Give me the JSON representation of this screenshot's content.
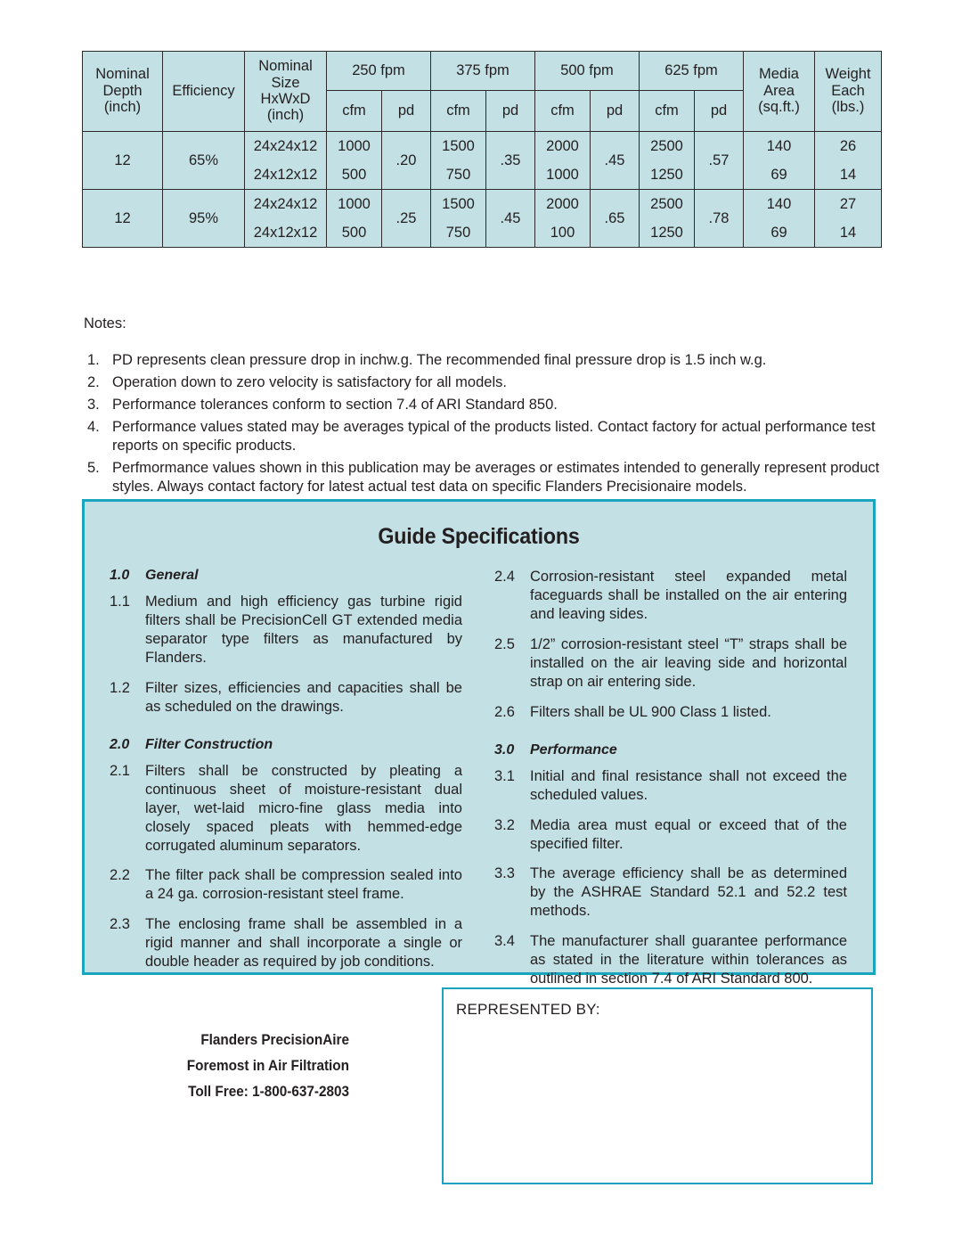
{
  "table": {
    "headers": {
      "nominal_depth": [
        "Nominal",
        "Depth",
        "(inch)"
      ],
      "efficiency": "Efficiency",
      "nominal_size": [
        "Nominal",
        "Size",
        "HxWxD",
        "(inch)"
      ],
      "velocity_groups": [
        "250 fpm",
        "375 fpm",
        "500 fpm",
        "625 fpm"
      ],
      "sub_cfm": "cfm",
      "sub_pd": "pd",
      "media_area": [
        "Media",
        "Area",
        "(sq.ft.)"
      ],
      "weight_each": [
        "Weight",
        "Each",
        "(lbs.)"
      ]
    },
    "rows": [
      {
        "depth": "12",
        "efficiency": "65%",
        "sizes": [
          "24x24x12",
          "24x12x12"
        ],
        "cfm_250": [
          "1000",
          "500"
        ],
        "pd_250": ".20",
        "cfm_375": [
          "1500",
          "750"
        ],
        "pd_375": ".35",
        "cfm_500": [
          "2000",
          "1000"
        ],
        "pd_500": ".45",
        "cfm_625": [
          "2500",
          "1250"
        ],
        "pd_625": ".57",
        "media_area": [
          "140",
          "69"
        ],
        "weight": [
          "26",
          "14"
        ]
      },
      {
        "depth": "12",
        "efficiency": "95%",
        "sizes": [
          "24x24x12",
          "24x12x12"
        ],
        "cfm_250": [
          "1000",
          "500"
        ],
        "pd_250": ".25",
        "cfm_375": [
          "1500",
          "750"
        ],
        "pd_375": ".45",
        "cfm_500": [
          "2000",
          "100"
        ],
        "pd_500": ".65",
        "cfm_625": [
          "2500",
          "1250"
        ],
        "pd_625": ".78",
        "media_area": [
          "140",
          "69"
        ],
        "weight": [
          "27",
          "14"
        ]
      }
    ]
  },
  "notes": {
    "label": "Notes:",
    "items": [
      {
        "num": "1.",
        "text": "PD represents clean pressure drop in inchw.g. The recommended final pressure drop is 1.5 inch w.g."
      },
      {
        "num": "2.",
        "text": "Operation down to zero velocity is satisfactory for all models."
      },
      {
        "num": "3.",
        "text": "Performance tolerances conform to section 7.4 of ARI Standard 850."
      },
      {
        "num": "4.",
        "text": "Performance values stated may be averages typical of the products listed. Contact factory for actual performance test reports on specific products."
      },
      {
        "num": "5.",
        "text": "Perfmormance values shown in this publication may be averages or estimates intended to generally represent product styles.  Always contact factory for latest actual test data on specific Flanders Precisionaire models."
      }
    ]
  },
  "guide": {
    "title": "Guide Specifications",
    "left_column": [
      {
        "kind": "section",
        "num": "1.0",
        "text": "General"
      },
      {
        "kind": "item",
        "num": "1.1",
        "text": "Medium and high efficiency gas turbine rigid filters shall be PrecisionCell GT extended media separator type filters as manufactured by Flanders."
      },
      {
        "kind": "item",
        "num": "1.2",
        "text": "Filter sizes, efficiencies and capacities shall be as scheduled on the drawings."
      },
      {
        "kind": "section",
        "num": "2.0",
        "text": "Filter Construction"
      },
      {
        "kind": "item",
        "num": "2.1",
        "text": "Filters shall be constructed by pleating a continuous sheet of moisture-resistant dual layer, wet-laid micro-fine glass media into closely spaced pleats with hemmed-edge corrugated aluminum separators."
      },
      {
        "kind": "item",
        "num": "2.2",
        "text": "The filter pack shall be compression sealed into a 24 ga. corrosion-resistant steel frame."
      },
      {
        "kind": "item",
        "num": "2.3",
        "text": "The enclosing frame shall be assembled in a rigid manner and shall incorporate a single or double header as required by job conditions."
      }
    ],
    "right_column": [
      {
        "kind": "item",
        "num": "2.4",
        "text": "Corrosion-resistant steel expanded metal faceguards shall be installed on the air entering and leaving sides."
      },
      {
        "kind": "item",
        "num": "2.5",
        "text": "1/2” corrosion-resistant steel “T” straps shall be installed on the air leaving side and horizontal strap on air entering side."
      },
      {
        "kind": "item",
        "num": "2.6",
        "text": "Filters shall be UL 900 Class 1 listed."
      },
      {
        "kind": "section",
        "num": "3.0",
        "text": "Performance"
      },
      {
        "kind": "item",
        "num": "3.1",
        "text": "Initial and final resistance shall not exceed the scheduled values."
      },
      {
        "kind": "item",
        "num": "3.2",
        "text": "Media area must equal or exceed that of the specified filter."
      },
      {
        "kind": "item",
        "num": "3.3",
        "text": "The average efficiency shall be as determined by the ASHRAE Standard 52.1 and 52.2 test methods."
      },
      {
        "kind": "item",
        "num": "3.4",
        "text": "The manufacturer shall guarantee performance as stated in the literature within tolerances as outlined in section 7.4 of ARI Standard 800."
      }
    ]
  },
  "footer": {
    "brand_lines": [
      "Flanders PrecisionAire",
      "Foremost in Air Filtration",
      "Toll Free: 1-800-637-2803"
    ],
    "represented_by_label": "REPRESENTED BY:"
  },
  "colors": {
    "table_fill": "#c3e0e5",
    "panel_fill": "#c3e0e5",
    "accent_border": "#19a5bd",
    "text": "#231f20"
  }
}
